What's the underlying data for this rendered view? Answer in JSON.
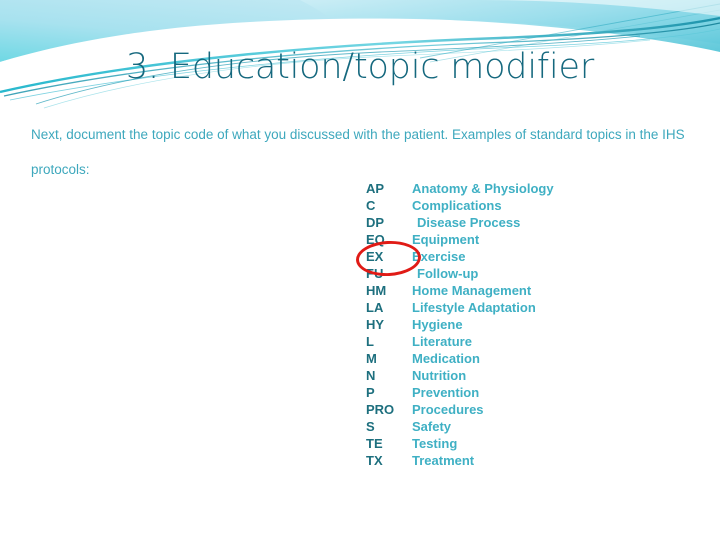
{
  "slide": {
    "title": "3. Education/topic modifier",
    "body": "Next, document the topic code of what you discussed with the patient. Examples of standard topics in the IHS protocols:",
    "colors": {
      "title": "#15687e",
      "body": "#3ea8bd",
      "code": "#1d6f7e",
      "description": "#3fb0c4",
      "annotation": "#e01b16",
      "band_light": "#b5e4f0",
      "band_cyan": "#38c6d8",
      "band_teal": "#1a8fa5",
      "background": "#ffffff"
    }
  },
  "topic_codes": [
    {
      "code": "AP",
      "description": "Anatomy & Physiology",
      "indented": false
    },
    {
      "code": "C",
      "description": "Complications",
      "indented": false
    },
    {
      "code": "DP",
      "description": "Disease Process",
      "indented": true
    },
    {
      "code": "EQ",
      "description": "Equipment",
      "indented": false
    },
    {
      "code": "EX",
      "description": "Exercise",
      "indented": false
    },
    {
      "code": "FU",
      "description": "Follow-up",
      "indented": true
    },
    {
      "code": "HM",
      "description": "Home Management",
      "indented": false
    },
    {
      "code": "LA",
      "description": "Lifestyle Adaptation",
      "indented": false
    },
    {
      "code": "HY",
      "description": "Hygiene",
      "indented": false
    },
    {
      "code": "L",
      "description": "Literature",
      "indented": false
    },
    {
      "code": "M",
      "description": "Medication",
      "indented": false
    },
    {
      "code": "N",
      "description": "Nutrition",
      "indented": false
    },
    {
      "code": "P",
      "description": "Prevention",
      "indented": false
    },
    {
      "code": "PRO",
      "description": "Procedures",
      "indented": false
    },
    {
      "code": "S",
      "description": "Safety",
      "indented": false
    },
    {
      "code": "TE",
      "description": "Testing",
      "indented": false
    },
    {
      "code": "TX",
      "description": "Treatment",
      "indented": false
    }
  ],
  "annotation": {
    "label": "red-ellipse-around-EX",
    "target_code": "EX"
  }
}
